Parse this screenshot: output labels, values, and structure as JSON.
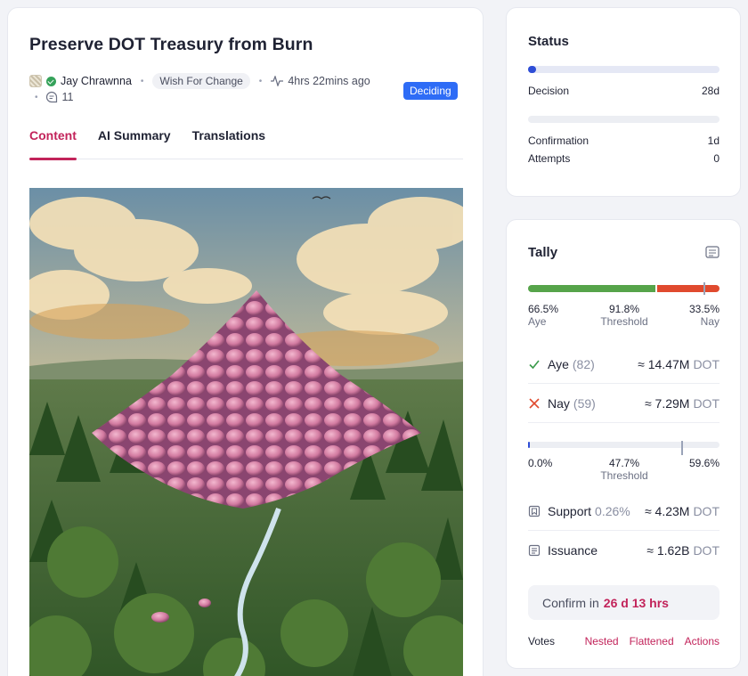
{
  "proposal": {
    "title": "Preserve DOT Treasury from Burn",
    "author": "Jay Chrawnna",
    "track": "Wish For Change",
    "time_ago": "4hrs 22mins ago",
    "comments": "11",
    "status": "Deciding"
  },
  "tabs": [
    {
      "label": "Content",
      "active": true
    },
    {
      "label": "AI Summary",
      "active": false
    },
    {
      "label": "Translations",
      "active": false
    }
  ],
  "status_card": {
    "title": "Status",
    "decision_label": "Decision",
    "decision_value": "28d",
    "decision_progress": 0.04,
    "confirmation_label": "Confirmation",
    "confirmation_value": "1d",
    "confirmation_progress": 0,
    "attempts_label": "Attempts",
    "attempts_value": "0"
  },
  "tally": {
    "title": "Tally",
    "approval": {
      "aye_pct": "66.5%",
      "aye_label": "Aye",
      "threshold_pct": "91.8%",
      "threshold_label": "Threshold",
      "nay_pct": "33.5%",
      "nay_label": "Nay",
      "aye_fraction": 0.665,
      "threshold_fraction": 0.918
    },
    "aye": {
      "label": "Aye",
      "count": "(82)",
      "amount": "≈ 14.47M",
      "unit": "DOT"
    },
    "nay": {
      "label": "Nay",
      "count": "(59)",
      "amount": "≈ 7.29M",
      "unit": "DOT"
    },
    "support_bar": {
      "min": "0.0%",
      "threshold_pct": "47.7%",
      "threshold_label": "Threshold",
      "max": "59.6%",
      "current_fraction": 0.0044,
      "threshold_fraction": 0.8
    },
    "support": {
      "label": "Support",
      "pct": "0.26%",
      "amount": "≈ 4.23M",
      "unit": "DOT"
    },
    "issuance": {
      "label": "Issuance",
      "amount": "≈ 1.62B",
      "unit": "DOT"
    },
    "confirm": {
      "prefix": "Confirm in",
      "value": "26 d 13 hrs"
    },
    "votes": {
      "label": "Votes",
      "links": [
        "Nested",
        "Flattened",
        "Actions"
      ]
    }
  },
  "colors": {
    "accent": "#c2235a",
    "status_blue": "#2e6cf6",
    "aye_green": "#56a44a",
    "nay_red": "#e04a2e",
    "progress_blue": "#2e4dd6"
  }
}
